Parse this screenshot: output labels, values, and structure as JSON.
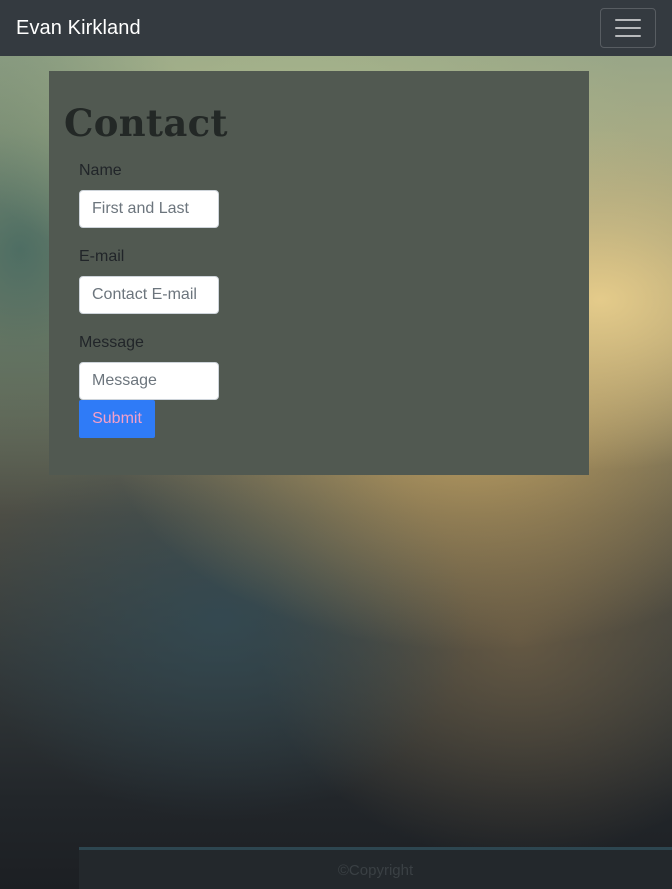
{
  "navbar": {
    "brand": "Evan Kirkland",
    "toggler_icon": "hamburger-menu-icon"
  },
  "contact": {
    "title": "Contact",
    "fields": {
      "name": {
        "label": "Name",
        "placeholder": "First and Last",
        "value": ""
      },
      "email": {
        "label": "E-mail",
        "placeholder": "Contact E-mail",
        "value": ""
      },
      "message": {
        "label": "Message",
        "placeholder": "Message",
        "value": ""
      }
    },
    "submit_label": "Submit"
  },
  "footer": {
    "text": "©Copyright"
  },
  "colors": {
    "navbar": "#343a40",
    "panel": "#515951",
    "submit_button": "#2f7bf7",
    "submit_text": "#f5a0c8"
  }
}
